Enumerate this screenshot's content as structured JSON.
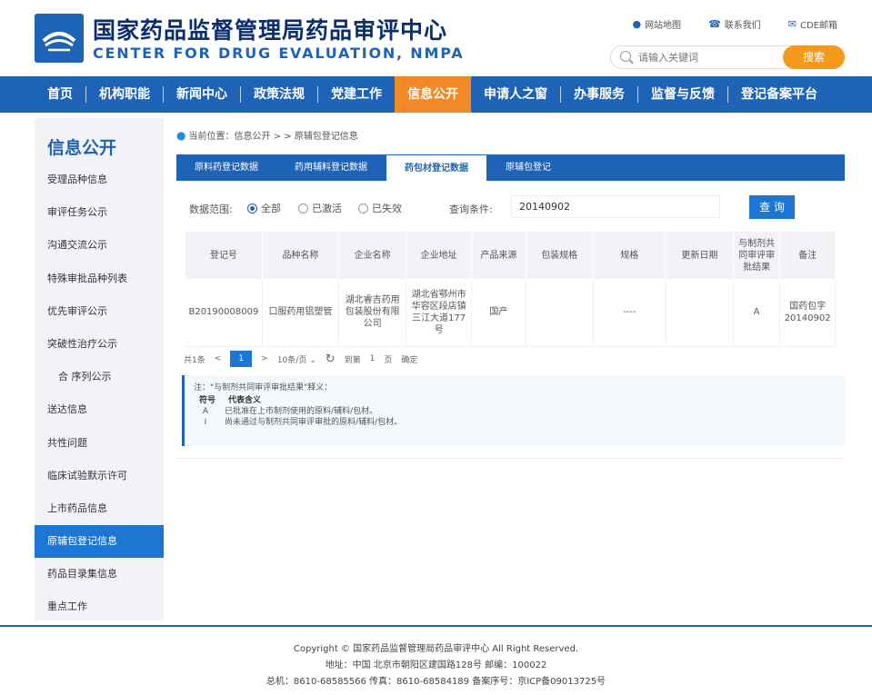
{
  "header": {
    "title_cn": "国家药品监督管理局药品审评中心",
    "title_en": "CENTER FOR DRUG EVALUATION, NMPA",
    "links": [
      {
        "icon": "location-pin-icon",
        "label": "网站地图"
      },
      {
        "icon": "phone-icon",
        "label": "联系我们"
      },
      {
        "icon": "mail-icon",
        "label": "CDE邮箱"
      }
    ],
    "search": {
      "placeholder": "请输入关键词",
      "button": "搜索"
    }
  },
  "nav": {
    "items": [
      "首页",
      "机构职能",
      "新闻中心",
      "政策法规",
      "党建工作",
      "信息公开",
      "申请人之窗",
      "办事服务",
      "监督与反馈",
      "登记备案平台"
    ],
    "active_index": 5
  },
  "sidebar": {
    "title": "信息公开",
    "items": [
      "受理品种信息",
      "审评任务公示",
      "沟通交流公示",
      "特殊审批品种列表",
      "优先审评公示",
      "突破性治疗公示",
      "合 序列公示",
      "送达信息",
      "共性问题",
      "临床试验默示许可",
      "上市药品信息",
      "原辅包登记信息",
      "药品目录集信息",
      "重点工作"
    ],
    "active_index": 11
  },
  "main": {
    "breadcrumb": "当前位置：信息公开 > > 原辅包登记信息",
    "tabs": [
      "原料药登记数据",
      "药用辅料登记数据",
      "药包材登记数据",
      "原辅包登记"
    ],
    "active_tab": 2,
    "filter": {
      "range_label": "数据范围:",
      "options": [
        "全部",
        "已激活",
        "已失效"
      ],
      "selected": 0,
      "condition_label": "查询条件:",
      "condition_value": "20140902",
      "query_button": "查 询"
    },
    "table": {
      "headers": [
        "登记号",
        "品种名称",
        "企业名称",
        "企业地址",
        "产品来源",
        "包装规格",
        "规格",
        "更新日期",
        "与制剂共同审评审批结果",
        "备注"
      ],
      "rows": [
        [
          "B20190008009",
          "口服药用铝塑管",
          "湖北睿吉药用包装股份有限公司",
          "湖北省鄂州市华容区段店镇三江大道177号",
          "国产",
          "",
          "----",
          "",
          "A",
          "国药包字20140902"
        ]
      ]
    },
    "pager": {
      "total": "共1条",
      "prev": "<",
      "current": "1",
      "next": ">",
      "page_size": "10条/页",
      "goto_label": "到第",
      "goto_value": "1",
      "page_unit": "页",
      "confirm": "确定"
    },
    "note": {
      "head": "注：\"与制剂共同审评审批结果\"释义：",
      "col_sym": "符号",
      "col_meaning": "代表含义",
      "items": [
        {
          "sym": "A",
          "text": "已批准在上市制剂使用的原料/辅料/包材。"
        },
        {
          "sym": "I",
          "text": "尚未通过与制剂共同审评审批的原料/辅料/包材。"
        }
      ]
    }
  },
  "footer": {
    "line1": "Copyright © 国家药品监督管理局药品审评中心   All Right Reserved.",
    "line2": "地址：中国 北京市朝阳区建国路128号    邮编：100022",
    "line3": "总机：8610-68585566    传真：8610-68584189    备案序号：京ICP备09013725号"
  },
  "colors": {
    "brand_blue": "#1e63b5",
    "accent_orange": "#f39a1d",
    "active_blue": "#1e76d3"
  }
}
